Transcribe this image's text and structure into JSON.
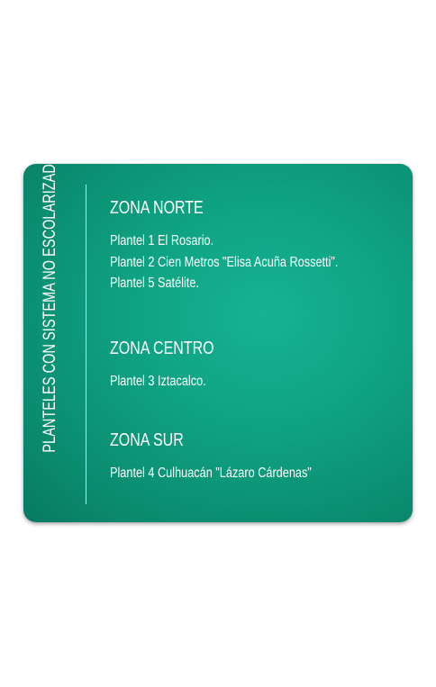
{
  "side_title": "PLANTELES CON SISTEMA NO ESCOLARIZADO",
  "zones": [
    {
      "name": "ZONA NORTE",
      "planteles": [
        "Plantel 1 El Rosario.",
        "Plantel 2 Cien Metros \"Elisa Acuña Rossetti\".",
        "Plantel 5 Satélite."
      ]
    },
    {
      "name": "ZONA CENTRO",
      "planteles": [
        "Plantel 3 Iztacalco."
      ]
    },
    {
      "name": "ZONA SUR",
      "planteles": [
        "Plantel 4 Culhuacán \"Lázaro Cárdenas\""
      ]
    }
  ],
  "colors": {
    "card_background": "#0fa282",
    "text": "#ffffff"
  }
}
